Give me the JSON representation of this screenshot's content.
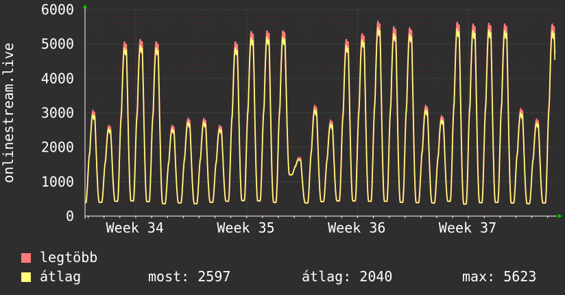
{
  "chart_data": {
    "type": "line",
    "ylabel": "onlinestream.live",
    "ylim": [
      0,
      6000
    ],
    "yticks": [
      0,
      1000,
      2000,
      3000,
      4000,
      5000,
      6000
    ],
    "xtick_labels": [
      "Week 34",
      "Week 35",
      "Week 36",
      "Week 37"
    ],
    "grid": true,
    "daily_peaks": [
      3050,
      2620,
      5080,
      5150,
      5080,
      2620,
      2820,
      2820,
      2620,
      5080,
      5380,
      5400,
      5400,
      1700,
      3200,
      2770,
      5150,
      5320,
      5680,
      5520,
      5490,
      3200,
      2900,
      5650,
      5600,
      5620,
      5600,
      3100,
      2800,
      5600
    ],
    "daily_troughs": [
      380,
      400,
      430,
      440,
      420,
      360,
      380,
      360,
      400,
      430,
      450,
      440,
      400,
      1200,
      380,
      420,
      440,
      440,
      430,
      430,
      400,
      390,
      380,
      430,
      350,
      390,
      400,
      380,
      360,
      380
    ],
    "series": [
      {
        "name": "legtöbb",
        "color": "#ff7b7b"
      },
      {
        "name": "átlag",
        "color": "#ffff7b"
      }
    ]
  },
  "legend": {
    "max_label": "legtöbb",
    "avg_label": "átlag",
    "now_stat": "most: 2597",
    "avg_stat": "átlag: 2040",
    "max_stat": "max: 5623"
  },
  "colors": {
    "background": "#2e2e2e",
    "plot_background": "#2e2e2e",
    "grid_minor": "#4a2424",
    "grid_major": "#5a5a5a",
    "axis": "#ffffff",
    "arrow": "#00cc00",
    "max_series": "#ff7b7b",
    "avg_series": "#ffff7b"
  }
}
